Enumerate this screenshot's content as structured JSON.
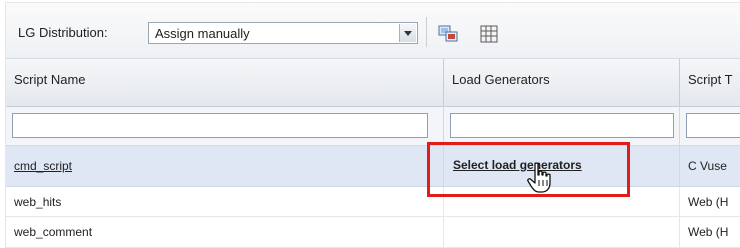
{
  "toolbar": {
    "distribution_label": "LG Distribution:",
    "distribution_value": "Assign manually",
    "icons": [
      "assign-load-generators-icon",
      "grid-view-icon"
    ]
  },
  "grid": {
    "columns": [
      "Script Name",
      "Load Generators",
      "Script T"
    ],
    "rows": [
      {
        "script_name": "cmd_script",
        "load_generators": "Select load generators",
        "script_type": "C Vuse",
        "selected": true
      },
      {
        "script_name": "web_hits",
        "load_generators": "",
        "script_type": "Web (H",
        "selected": false
      },
      {
        "script_name": "web_comment",
        "load_generators": "",
        "script_type": "Web (H",
        "selected": false
      }
    ]
  },
  "colors": {
    "highlight": "#e21b1b",
    "selected_row": "#dfe7f5"
  }
}
